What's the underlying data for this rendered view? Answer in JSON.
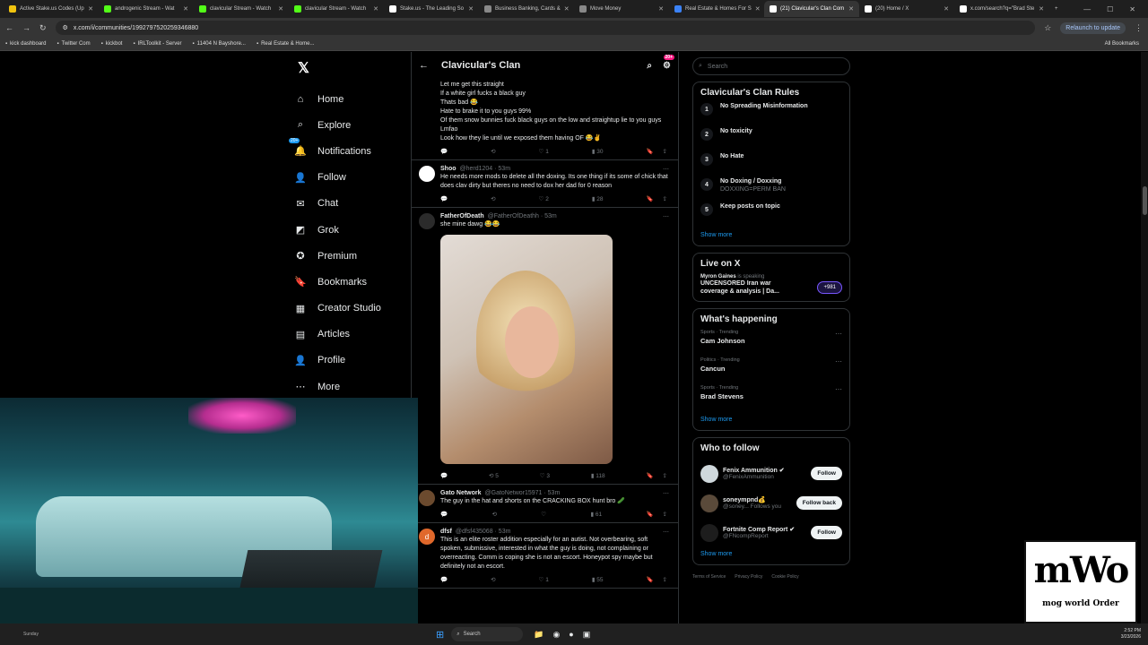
{
  "browser": {
    "tabs": [
      {
        "label": "Active Stake.us Codes (Up",
        "color": "#f1c40f"
      },
      {
        "label": "androgenic Stream - Wat",
        "color": "#53fc18"
      },
      {
        "label": "clavicular Stream - Watch",
        "color": "#53fc18"
      },
      {
        "label": "clavicular Stream - Watch",
        "color": "#53fc18"
      },
      {
        "label": "Stake.us - The Leading So",
        "color": "#ffffff"
      },
      {
        "label": "Business Banking, Cards &",
        "color": "#888888"
      },
      {
        "label": "Move Money",
        "color": "#888888"
      },
      {
        "label": "Real Estate & Homes For S",
        "color": "#3b82f6"
      },
      {
        "label": "(21) Clavicular's Clan Com",
        "color": "#ffffff",
        "active": true
      },
      {
        "label": "(20) Home / X",
        "color": "#ffffff"
      },
      {
        "label": "x.com/search?q=\"Brad Ste",
        "color": "#ffffff"
      }
    ],
    "url": "x.com/i/communities/1992797520259346880",
    "relaunch_label": "Relaunch to update",
    "bookmarks": [
      "kick dashboard",
      "Twitter Com",
      "kickbot",
      "IRLToolkit - Server",
      "11404 N Bayshore...",
      "Real Estate & Home..."
    ],
    "all_bookmarks": "All Bookmarks"
  },
  "nav": {
    "items": [
      {
        "label": "Home",
        "icon": "⌂"
      },
      {
        "label": "Explore",
        "icon": "⌕"
      },
      {
        "label": "Notifications",
        "icon": "🔔",
        "badge": "20+"
      },
      {
        "label": "Follow",
        "icon": "👤"
      },
      {
        "label": "Chat",
        "icon": "✉"
      },
      {
        "label": "Grok",
        "icon": "◩"
      },
      {
        "label": "Premium",
        "icon": "✪"
      },
      {
        "label": "Bookmarks",
        "icon": "🔖"
      },
      {
        "label": "Creator Studio",
        "icon": "▦"
      },
      {
        "label": "Articles",
        "icon": "▤"
      },
      {
        "label": "Profile",
        "icon": "👤"
      },
      {
        "label": "More",
        "icon": "⋯"
      }
    ]
  },
  "community": {
    "title": "Clavicular's Clan",
    "badge": "20+"
  },
  "posts": [
    {
      "name": "",
      "handle": "",
      "time": "",
      "body": "Let me get this straight\nIf a white girl fucks a black guy\nThats bad 😂\nHate to brake it to you guys 99%\nOf them snow bunnies fuck black guys on the low and straightup lie to you guys\nLmfao\nLook how they lie until we exposed them having OF 😂✌",
      "reply": "",
      "repost": "",
      "like": "1",
      "views": "30"
    },
    {
      "name": "Shoo",
      "handle": "@herd1204 · 53m",
      "time": "",
      "body": "He needs more mods to delete all the doxing. Its one thing if its some of chick that does clav dirty but theres no need to dox her dad for 0 reason",
      "reply": "",
      "repost": "",
      "like": "2",
      "views": "28"
    },
    {
      "name": "FatherOfDeath",
      "handle": "@FatherOfDeathh · 53m",
      "time": "",
      "body": "she mine dawg 😂😂",
      "reply": "",
      "repost": "5",
      "like": "3",
      "views": "118",
      "has_photo": true
    },
    {
      "name": "Gato Network",
      "handle": "@GatoNetwor15971 · 53m",
      "time": "",
      "body": "The guy in the hat and shorts on the CRACKING BOX hunt bro 🥒",
      "reply": "",
      "repost": "",
      "like": "",
      "views": "61"
    },
    {
      "name": "dfsf",
      "handle": "@dfsf435068 · 53m",
      "time": "",
      "body": "This is an elite roster addition especially for an autist. Not overbearing, soft spoken, submissive, interested in what the guy is doing, not complaining or overreacting. Comm is coping she is not an escort. Honeypot spy maybe but definitely not an escort.",
      "reply": "",
      "repost": "",
      "like": "1",
      "views": "55"
    }
  ],
  "sidebar": {
    "search_placeholder": "Search",
    "rules_title": "Clavicular's Clan Rules",
    "rules": [
      {
        "num": "1",
        "text": "No Spreading Misinformation",
        "sub": ""
      },
      {
        "num": "2",
        "text": "No toxicity",
        "sub": ""
      },
      {
        "num": "3",
        "text": "No Hate",
        "sub": ""
      },
      {
        "num": "4",
        "text": "No Doxing / Doxxing",
        "sub": "DOXXING=PERM BAN"
      },
      {
        "num": "5",
        "text": "Keep posts on topic",
        "sub": ""
      }
    ],
    "show_more": "Show more",
    "live_title": "Live on X",
    "live_host": "Myron Gaines",
    "live_status": "is speaking",
    "live_topic": "UNCENSORED Iran war coverage & analysis | Da...",
    "live_count": "+981",
    "happening_title": "What's happening",
    "trends": [
      {
        "cat": "Sports · Trending",
        "name": "Cam Johnson"
      },
      {
        "cat": "Politics · Trending",
        "name": "Cancun"
      },
      {
        "cat": "Sports · Trending",
        "name": "Brad Stevens"
      }
    ],
    "wtf_title": "Who to follow",
    "follow": [
      {
        "name": "Fenix Ammunition ✔",
        "handle": "@FenixAmmunition",
        "btn": "Follow"
      },
      {
        "name": "soneympnd💰",
        "handle": "@soney...  Follows you",
        "btn": "Follow back"
      },
      {
        "name": "Fortnite Comp Report ✔",
        "handle": "@FNcompReport",
        "btn": "Follow"
      }
    ],
    "footer": [
      "Terms of Service",
      "Privacy Policy",
      "Cookie Policy"
    ]
  },
  "watermark": {
    "big": "mWo",
    "small": "mog world Order"
  },
  "taskbar": {
    "day": "Sunday",
    "search": "Search",
    "time": "2:52 PM",
    "date": "3/23/2026"
  }
}
